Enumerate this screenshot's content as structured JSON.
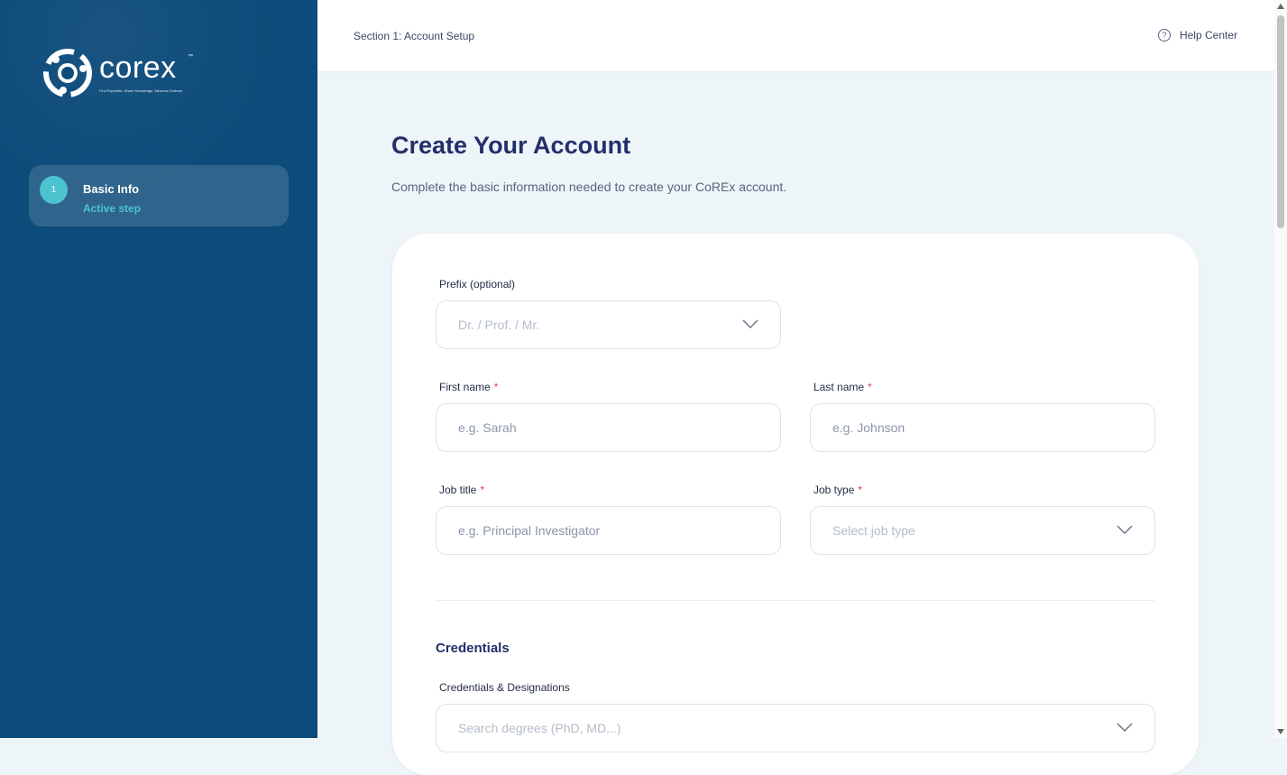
{
  "brand": {
    "name": "corex",
    "trademark": "™",
    "tagline": "Find Expertise. Share Knowledge. Advance Science."
  },
  "sidebar": {
    "steps": [
      {
        "number": "1",
        "title": "Basic Info",
        "status": "Active step"
      }
    ]
  },
  "header": {
    "section": "Section 1: Account Setup",
    "help_label": "Help Center",
    "help_icon": "?"
  },
  "page": {
    "title": "Create Your Account",
    "subtitle": "Complete the basic information needed to create your CoREx account."
  },
  "form": {
    "prefix": {
      "label": "Prefix (optional)",
      "placeholder": "Dr. / Prof. / Mr."
    },
    "first_name": {
      "label": "First name",
      "required_mark": "*",
      "placeholder": "e.g. Sarah"
    },
    "last_name": {
      "label": "Last name",
      "required_mark": "*",
      "placeholder": "e.g. Johnson"
    },
    "job_title": {
      "label": "Job title",
      "required_mark": "*",
      "placeholder": "e.g. Principal Investigator"
    },
    "job_type": {
      "label": "Job type",
      "required_mark": "*",
      "placeholder": "Select job type"
    },
    "credentials_section": "Credentials",
    "credentials": {
      "label": "Credentials & Designations",
      "placeholder": "Search degrees (PhD, MD...)"
    }
  },
  "colors": {
    "sidebar_bg": "#0d4b7a",
    "accent": "#4cc3cf",
    "title": "#242e6b",
    "required": "#e0424f"
  }
}
